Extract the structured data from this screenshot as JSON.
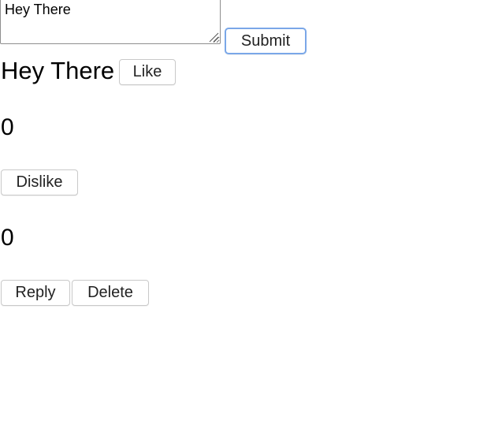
{
  "composer": {
    "input_value": "Hey There",
    "submit_label": "Submit"
  },
  "comment": {
    "text": "Hey There",
    "like_label": "Like",
    "likes_count": "0",
    "dislike_label": "Dislike",
    "dislikes_count": "0",
    "reply_label": "Reply",
    "delete_label": "Delete"
  },
  "colors": {
    "focus_ring": "#7aa7e8",
    "button_border": "#c9c9c9"
  }
}
